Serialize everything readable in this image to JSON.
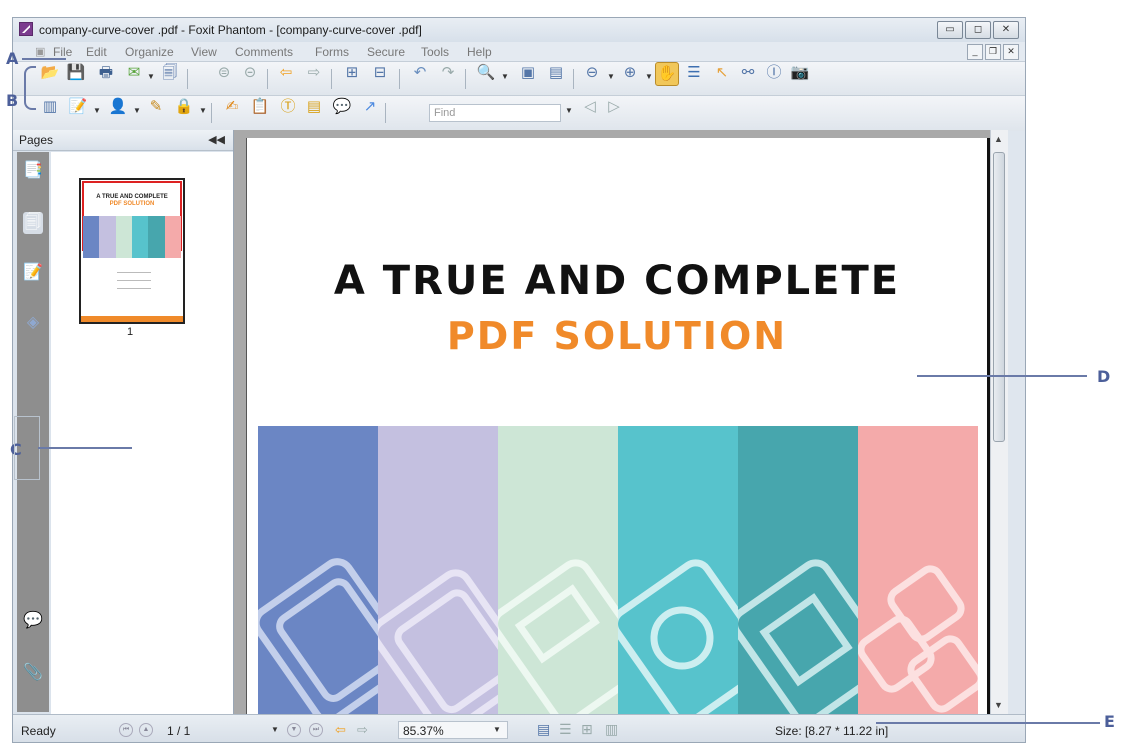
{
  "window": {
    "title": "company-curve-cover .pdf - Foxit Phantom - [company-curve-cover .pdf]"
  },
  "menu": [
    "File",
    "Edit",
    "Organize",
    "View",
    "Comments",
    "Forms",
    "Secure",
    "Tools",
    "Help"
  ],
  "toolbar": {
    "find_placeholder": "Find"
  },
  "pages_panel": {
    "title": "Pages",
    "thumbnail_label": "1"
  },
  "document": {
    "headline": "A TRUE AND COMPLETE",
    "subheadline": "PDF SOLUTION",
    "stripe_colors": [
      "#6b86c4",
      "#c4c0e0",
      "#cde6d6",
      "#57c3cc",
      "#47a6ad",
      "#f4aaaa"
    ],
    "headline_color": "#111111",
    "subheadline_color": "#f08a2a"
  },
  "status": {
    "ready": "Ready",
    "page_indicator": "1 / 1",
    "zoom": "85.37%",
    "size": "Size: [8.27 * 11.22 in]"
  },
  "callouts": {
    "a": "A",
    "b": "B",
    "c": "C",
    "d": "D",
    "e": "E"
  }
}
